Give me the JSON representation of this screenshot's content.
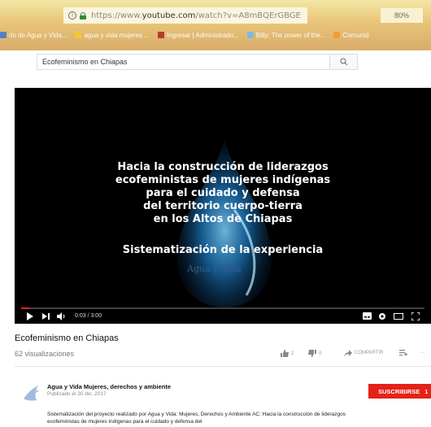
{
  "browser": {
    "url_prefix": "https://www.",
    "url_domain": "youtube.com",
    "url_path": "/watch?v=A8mBQErGBGE",
    "zoom": "80%",
    "bookmarks": [
      {
        "label": "rio de Agua y Vida...",
        "color": "#4a7fc8"
      },
      {
        "label": "agua y vida mujeres ...",
        "color": "#f3c637"
      },
      {
        "label": "Ingresar | Administrado...",
        "color": "#b5342e"
      },
      {
        "label": "Billy: The power of the...",
        "color": "#7ab8e8"
      },
      {
        "label": "Comunid",
        "color": "#f59a2f"
      }
    ]
  },
  "search": {
    "value": "Ecofeminismo en Chiapas"
  },
  "video": {
    "overlay_lines": [
      "Hacia la construcción de liderazgos",
      "ecofeministas de mujeres indígenas",
      "para el cuidado y defensa",
      "del territorio cuerpo-tierra",
      "en los Altos de Chiapas"
    ],
    "subtitle": "Sistematización de la experiencia",
    "watermark": "Agua y Vida",
    "time": "0:03 / 3:00",
    "progress": 0.02
  },
  "meta": {
    "title": "Ecofeminismo en Chiapas",
    "views": "62 visualizaciones",
    "likes": "2",
    "dislikes": "0",
    "share": "COMPARTIR",
    "more": "..."
  },
  "channel": {
    "name": "Agua y Vida Mujeres, derechos y ambiente",
    "published": "Publicado el 30 dic. 2017",
    "subscribe": "SUSCRIBIRSE",
    "subscribers": "1",
    "description": "Sistematización del proyecto realizado por Agua y Vida: Mujeres, Derechos y Ambiente AC: Hacia la construcción de liderazgos ecofeministas de mujeres indígenas para el cuidado y defensa del"
  },
  "colors": {
    "subscribe": "#e62117",
    "progress": "#e62117",
    "accent_drop": "#2fa6e8"
  }
}
